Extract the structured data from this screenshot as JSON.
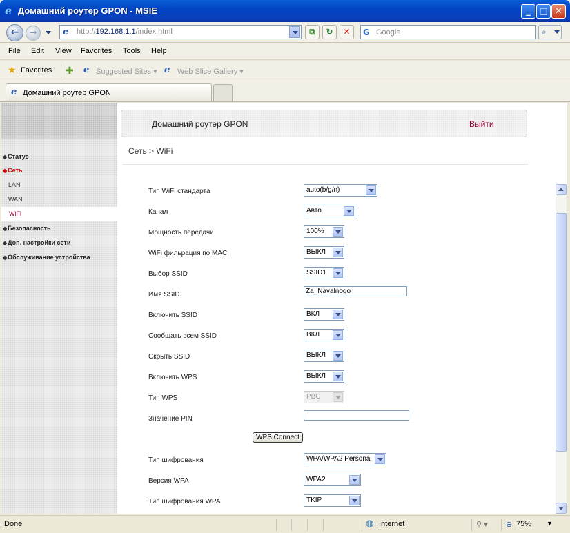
{
  "window": {
    "title": "Домашний роутер GPON - MSIE"
  },
  "navigation": {
    "address_prefix": "http://",
    "address_host": "192.168.1.1",
    "address_path": "/index.html",
    "search_placeholder": "Google"
  },
  "menu": [
    "File",
    "Edit",
    "View",
    "Favorites",
    "Tools",
    "Help"
  ],
  "favorites_bar": {
    "favorites_label": "Favorites",
    "links": [
      "Suggested Sites ▾",
      "Web Slice Gallery ▾"
    ]
  },
  "tab": {
    "label": "Домашний роутер GPON"
  },
  "router": {
    "header_title": "Домашний роутер GPON",
    "logout": "Выйти",
    "breadcrumb": "Сеть > WiFi"
  },
  "sidebar": {
    "items": [
      "Статус",
      "Сеть",
      "Безопасность",
      "Доп. настройки сети",
      "Обслуживание устройства"
    ],
    "subitems": [
      "LAN",
      "WAN",
      "WiFi"
    ]
  },
  "form": {
    "standard_label": "Тип WiFi стандарта",
    "standard_value": "auto(b/g/n)",
    "channel_label": "Канал",
    "channel_value": "Авто",
    "power_label": "Мощность передачи",
    "power_value": "100%",
    "mac_filter_label": "WiFi фильрация по MAC",
    "mac_filter_value": "ВЫКЛ",
    "ssid_select_label": "Выбор SSID",
    "ssid_select_value": "SSID1",
    "ssid_name_label": "Имя SSID",
    "ssid_name_value": "Za_Navalnogo",
    "ssid_enable_label": "Включить SSID",
    "ssid_enable_value": "ВКЛ",
    "broadcast_label": "Сообщать всем SSID",
    "broadcast_value": "ВКЛ",
    "hide_label": "Скрыть SSID",
    "hide_value": "ВЫКЛ",
    "wps_enable_label": "Включить WPS",
    "wps_enable_value": "ВЫКЛ",
    "wps_type_label": "Тип WPS",
    "wps_type_value": "PBC",
    "pin_label": "Значение PIN",
    "pin_value": "",
    "wps_connect": "WPS Connect",
    "encryption_label": "Тип шифрования",
    "encryption_value": "WPA/WPA2 Personal",
    "wpa_version_label": "Версия WPA",
    "wpa_version_value": "WPA2",
    "wpa_cipher_label": "Тип шифрования WPA",
    "wpa_cipher_value": "TKIP"
  },
  "statusbar": {
    "left": "Done",
    "zone": "Internet",
    "zoom": "75%"
  }
}
